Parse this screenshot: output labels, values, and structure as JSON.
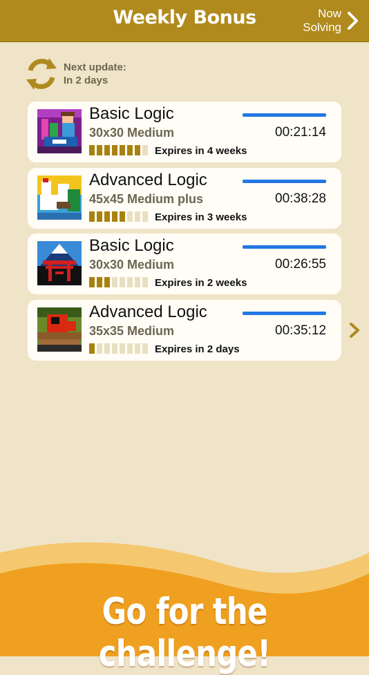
{
  "header": {
    "title": "Weekly Bonus",
    "now_solving_line1": "Now",
    "now_solving_line2": "Solving"
  },
  "update": {
    "line1": "Next update:",
    "line2": "In 2 days",
    "icon": "refresh-icon"
  },
  "puzzles": [
    {
      "title": "Basic Logic",
      "size": "30x30 Medium",
      "time": "00:21:14",
      "expires": "Expires in 4 weeks",
      "filled": 7,
      "total": 8,
      "image": "girl-with-flowers"
    },
    {
      "title": "Advanced Logic",
      "size": "45x45 Medium plus",
      "time": "00:38:28",
      "expires": "Expires in 3 weeks",
      "filled": 5,
      "total": 8,
      "image": "cranes"
    },
    {
      "title": "Basic Logic",
      "size": "30x30 Medium",
      "time": "00:26:55",
      "expires": "Expires in 2 weeks",
      "filled": 3,
      "total": 8,
      "image": "mount-fuji-torii"
    },
    {
      "title": "Advanced Logic",
      "size": "35x35 Medium",
      "time": "00:35:12",
      "expires": "Expires in 2 days",
      "filled": 1,
      "total": 8,
      "image": "red-monkey"
    }
  ],
  "footer": {
    "slogan": "Go for the challenge!"
  },
  "colors": {
    "header": "#b08a1c",
    "background": "#efe4c8",
    "progress": "#2277e3",
    "segment_on": "#a8820f",
    "wave": "#f0a020"
  }
}
